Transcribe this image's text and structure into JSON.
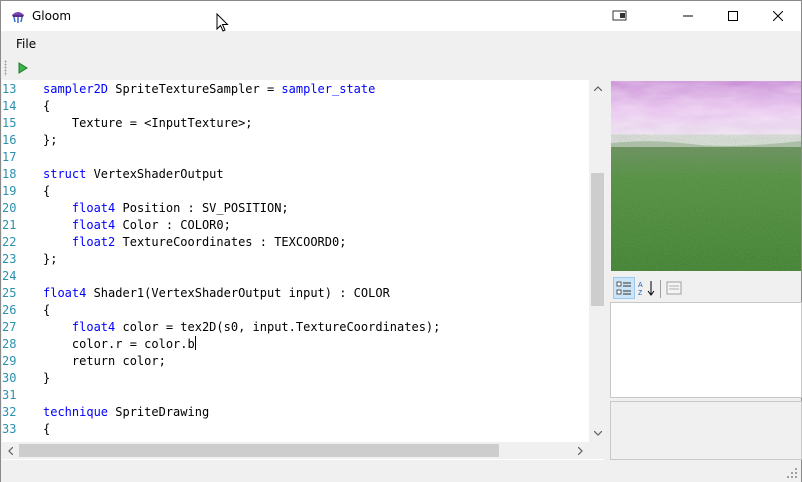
{
  "window": {
    "title": "Gloom",
    "controls": [
      "restore-window-icon",
      "minimize-icon",
      "maximize-icon",
      "close-icon"
    ]
  },
  "menu": {
    "file_label": "File"
  },
  "toolbar": {
    "run_icon": "play-icon"
  },
  "editor": {
    "lines": [
      {
        "num": "13",
        "segments": [
          {
            "t": "sampler2D",
            "kw": true
          },
          {
            "t": " SpriteTextureSampler = ",
            "kw": false
          },
          {
            "t": "sampler_state",
            "kw": true
          }
        ]
      },
      {
        "num": "14",
        "segments": [
          {
            "t": "{",
            "kw": false
          }
        ]
      },
      {
        "num": "15",
        "segments": [
          {
            "t": "    Texture = <InputTexture>;",
            "kw": false
          }
        ]
      },
      {
        "num": "16",
        "segments": [
          {
            "t": "};",
            "kw": false
          }
        ]
      },
      {
        "num": "17",
        "segments": []
      },
      {
        "num": "18",
        "segments": [
          {
            "t": "struct",
            "kw": true
          },
          {
            "t": " VertexShaderOutput",
            "kw": false
          }
        ]
      },
      {
        "num": "19",
        "segments": [
          {
            "t": "{",
            "kw": false
          }
        ]
      },
      {
        "num": "20",
        "segments": [
          {
            "t": "    ",
            "kw": false
          },
          {
            "t": "float4",
            "kw": true
          },
          {
            "t": " Position : SV_POSITION;",
            "kw": false
          }
        ]
      },
      {
        "num": "21",
        "segments": [
          {
            "t": "    ",
            "kw": false
          },
          {
            "t": "float4",
            "kw": true
          },
          {
            "t": " Color : COLOR0;",
            "kw": false
          }
        ]
      },
      {
        "num": "22",
        "segments": [
          {
            "t": "    ",
            "kw": false
          },
          {
            "t": "float2",
            "kw": true
          },
          {
            "t": " TextureCoordinates : TEXCOORD0;",
            "kw": false
          }
        ]
      },
      {
        "num": "23",
        "segments": [
          {
            "t": "};",
            "kw": false
          }
        ]
      },
      {
        "num": "24",
        "segments": []
      },
      {
        "num": "25",
        "segments": [
          {
            "t": "float4",
            "kw": true
          },
          {
            "t": " Shader1(VertexShaderOutput input) : COLOR",
            "kw": false
          }
        ]
      },
      {
        "num": "26",
        "segments": [
          {
            "t": "{",
            "kw": false
          }
        ]
      },
      {
        "num": "27",
        "segments": [
          {
            "t": "    ",
            "kw": false
          },
          {
            "t": "float4",
            "kw": true
          },
          {
            "t": " color = tex2D(s0, input.TextureCoordinates);",
            "kw": false
          }
        ]
      },
      {
        "num": "28",
        "segments": [
          {
            "t": "    color.r = color.b",
            "kw": false
          }
        ],
        "caret": true
      },
      {
        "num": "29",
        "segments": [
          {
            "t": "    return color;",
            "kw": false
          }
        ]
      },
      {
        "num": "30",
        "segments": [
          {
            "t": "}",
            "kw": false
          }
        ]
      },
      {
        "num": "31",
        "segments": []
      },
      {
        "num": "32",
        "segments": [
          {
            "t": "technique",
            "kw": true
          },
          {
            "t": " SpriteDrawing",
            "kw": false
          }
        ]
      },
      {
        "num": "33",
        "segments": [
          {
            "t": "{",
            "kw": false
          }
        ]
      }
    ],
    "vertical_scroll_position": 0.35,
    "horizontal_scroll_position": 0.0
  },
  "properties": {
    "categorized_icon": "categorized-view-icon",
    "alphabetical_icon": "alphabetical-sort-icon",
    "property_pages_icon": "property-pages-icon"
  },
  "colors": {
    "keyword": "#0000ff",
    "line_number": "#2b91af",
    "run_green": "#2e9e3a"
  }
}
